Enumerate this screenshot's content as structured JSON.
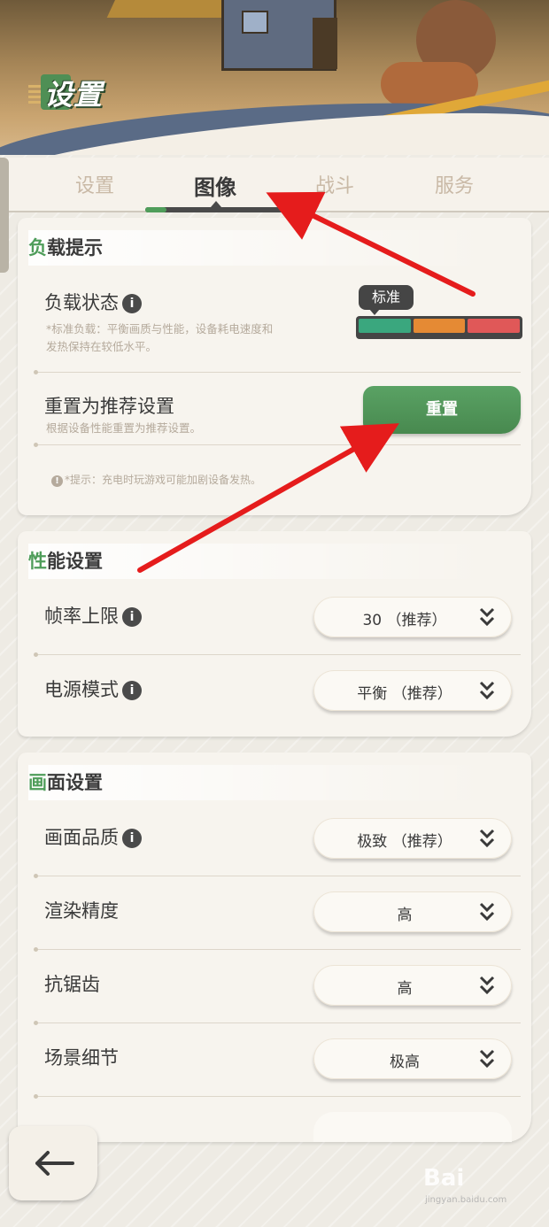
{
  "header": {
    "title": "设置"
  },
  "tabs": [
    {
      "label": "设置",
      "active": false
    },
    {
      "label": "图像",
      "active": true
    },
    {
      "label": "战斗",
      "active": false
    },
    {
      "label": "服务",
      "active": false
    }
  ],
  "load_section": {
    "title_first": "负",
    "title_rest": "载提示",
    "status_label": "负载状态",
    "status_desc_line1": "*标准负载：平衡画质与性能，设备耗电速度和",
    "status_desc_line2": "发热保持在较低水平。",
    "status_tag": "标准",
    "bar_colors": [
      "#3aa77e",
      "#e58a34",
      "#e05858"
    ],
    "reset_label": "重置为推荐设置",
    "reset_desc": "根据设备性能重置为推荐设置。",
    "reset_button": "重置",
    "hint_icon": "!",
    "hint": "*提示：充电时玩游戏可能加剧设备发热。"
  },
  "performance_section": {
    "title_first": "性",
    "title_rest": "能设置",
    "rows": [
      {
        "label": "帧率上限",
        "value": "30 （推荐）"
      },
      {
        "label": "电源模式",
        "value": "平衡 （推荐）"
      }
    ]
  },
  "display_section": {
    "title_first": "画",
    "title_rest": "面设置",
    "rows": [
      {
        "label": "画面品质",
        "value": "极致 （推荐）"
      },
      {
        "label": "渲染精度",
        "value": "高"
      },
      {
        "label": "抗锯齿",
        "value": "高"
      },
      {
        "label": "场景细节",
        "value": "极高"
      }
    ]
  },
  "info_icon_glyph": "i",
  "accent_green": "#4f9d5a",
  "watermark": {
    "brand": "Bai",
    "domain": "jingyan.baidu.com"
  }
}
